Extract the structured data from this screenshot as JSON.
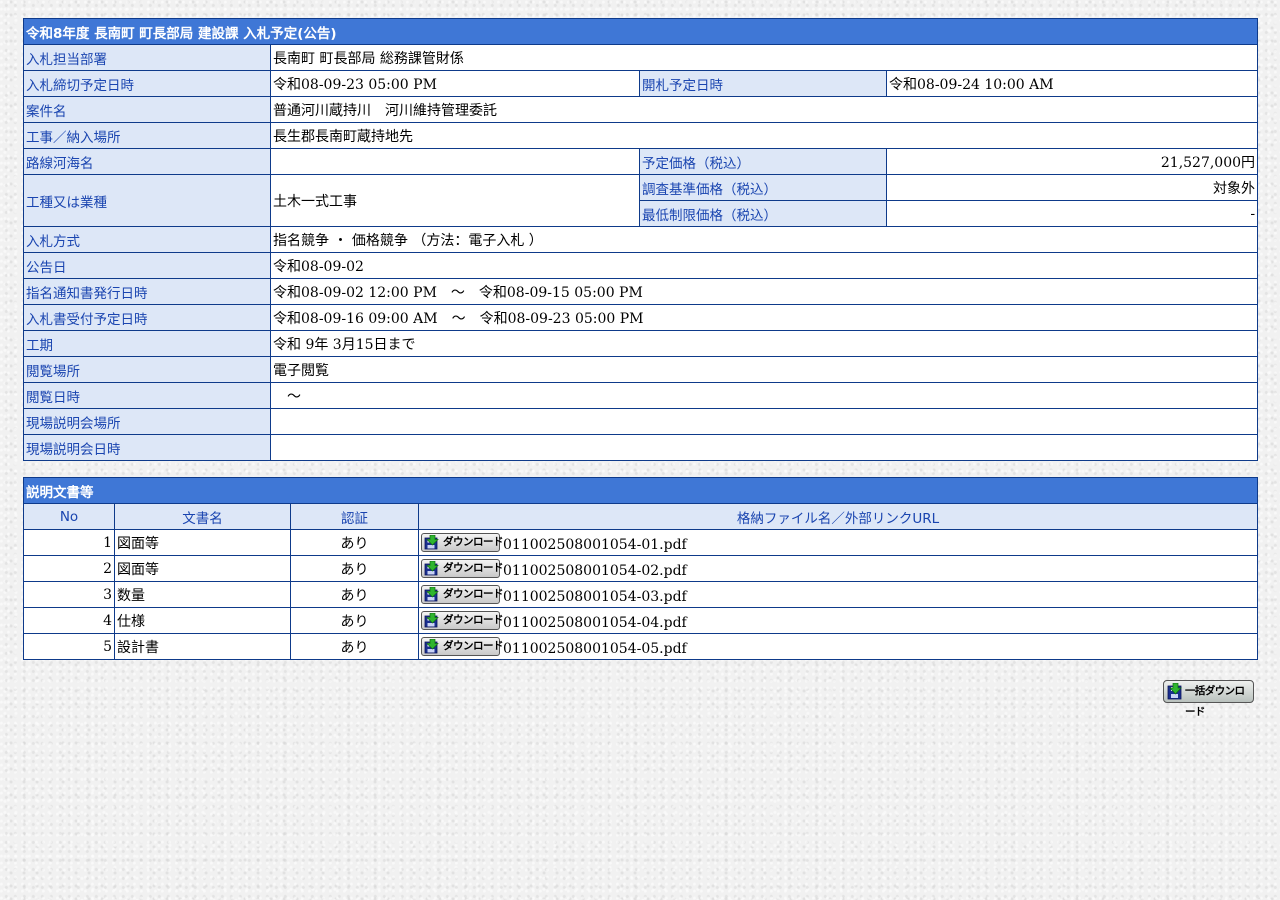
{
  "notice": {
    "title": "令和8年度 長南町 町長部局 建設課 入札予定(公告)",
    "rows": {
      "dept": {
        "label": "入札担当部署",
        "value": "長南町 町長部局 総務課管財係"
      },
      "deadline": {
        "label": "入札締切予定日時",
        "value": "令和08-09-23 05:00 PM"
      },
      "opening": {
        "label": "開札予定日時",
        "value": "令和08-09-24 10:00 AM"
      },
      "case_name": {
        "label": "案件名",
        "value": "普通河川蔵持川　河川維持管理委託"
      },
      "location": {
        "label": "工事／納入場所",
        "value": "長生郡長南町蔵持地先"
      },
      "route": {
        "label": "路線河海名",
        "value": ""
      },
      "planned_price": {
        "label": "予定価格（税込）",
        "value": "21,527,000円"
      },
      "work_type": {
        "label": "工種又は業種",
        "value": "土木一式工事"
      },
      "survey_price": {
        "label": "調査基準価格（税込）",
        "value": "対象外"
      },
      "min_price": {
        "label": "最低制限価格（税込）",
        "value": "-"
      },
      "method": {
        "label": "入札方式",
        "value": "指名競争 ・ 価格競争 （方法：電子入札 ）"
      },
      "announce_date": {
        "label": "公告日",
        "value": "令和08-09-02"
      },
      "nomination": {
        "label": "指名通知書発行日時",
        "value": "令和08-09-02 12:00 PM　～　令和08-09-15 05:00 PM"
      },
      "receipt": {
        "label": "入札書受付予定日時",
        "value": "令和08-09-16 09:00 AM　～　令和08-09-23 05:00 PM"
      },
      "period": {
        "label": "工期",
        "value": "令和 9年 3月15日まで"
      },
      "view_place": {
        "label": "閲覧場所",
        "value": "電子閲覧"
      },
      "view_date": {
        "label": "閲覧日時",
        "value": "　～"
      },
      "site_place": {
        "label": "現場説明会場所",
        "value": ""
      },
      "site_date": {
        "label": "現場説明会日時",
        "value": ""
      }
    }
  },
  "documents": {
    "title": "説明文書等",
    "headers": {
      "no": "No",
      "name": "文書名",
      "cert": "認証",
      "file": "格納ファイル名／外部リンクURL"
    },
    "download_label": "ダウンロード",
    "rows": [
      {
        "no": "1",
        "name": "図面等",
        "cert": "あり",
        "file": "011002508001054-01.pdf"
      },
      {
        "no": "2",
        "name": "図面等",
        "cert": "あり",
        "file": "011002508001054-02.pdf"
      },
      {
        "no": "3",
        "name": "数量",
        "cert": "あり",
        "file": "011002508001054-03.pdf"
      },
      {
        "no": "4",
        "name": "仕様",
        "cert": "あり",
        "file": "011002508001054-04.pdf"
      },
      {
        "no": "5",
        "name": "設計書",
        "cert": "あり",
        "file": "011002508001054-05.pdf"
      }
    ]
  },
  "bulk_download_label": "一括ダウンロード",
  "icons": {
    "download": "floppy-disk-download-icon"
  },
  "colors": {
    "header_bg": "#3f77d6",
    "label_bg": "#dde7f7",
    "label_text": "#1a45b0",
    "border": "#0e3a8a"
  }
}
